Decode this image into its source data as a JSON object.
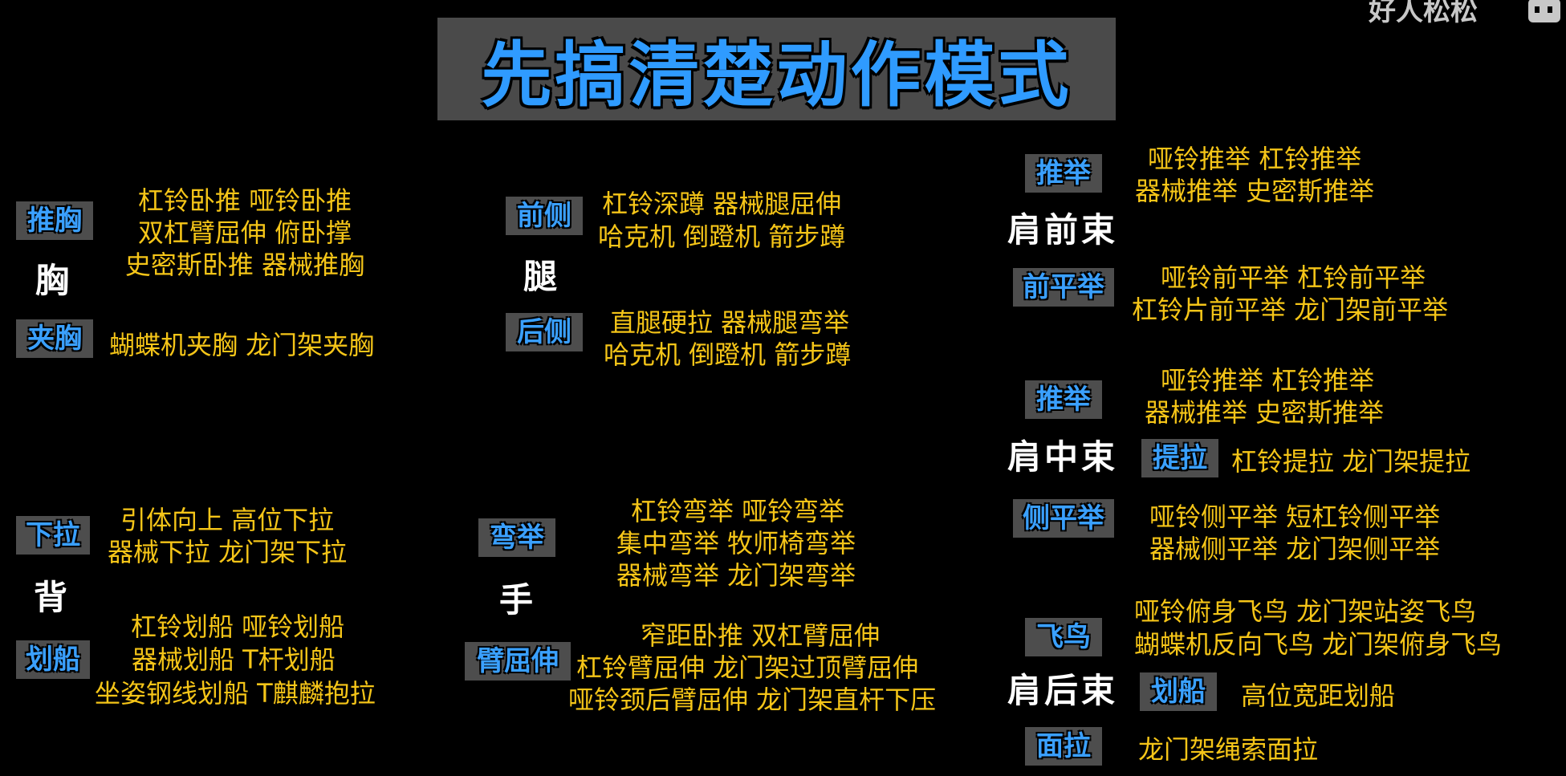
{
  "title": "先搞清楚动作模式",
  "watermark": "好人松松",
  "groups": {
    "chest": {
      "name": "胸",
      "push_tag": "推胸",
      "push_line1": "杠铃卧推 哑铃卧推",
      "push_line2": "双杠臂屈伸 俯卧撑",
      "push_line3": "史密斯卧推 器械推胸",
      "fly_tag": "夹胸",
      "fly_line1": "蝴蝶机夹胸 龙门架夹胸"
    },
    "legs": {
      "name": "腿",
      "front_tag": "前侧",
      "front_line1": "杠铃深蹲 器械腿屈伸",
      "front_line2": "哈克机 倒蹬机 箭步蹲",
      "back_tag": "后侧",
      "back_line1": "直腿硬拉 器械腿弯举",
      "back_line2": "哈克机 倒蹬机 箭步蹲"
    },
    "front_delt": {
      "name": "肩前束",
      "press_tag": "推举",
      "press_line1": "哑铃推举 杠铃推举",
      "press_line2": "器械推举 史密斯推举",
      "raise_tag": "前平举",
      "raise_line1": "哑铃前平举 杠铃前平举",
      "raise_line2": "杠铃片前平举 龙门架前平举"
    },
    "mid_delt": {
      "name": "肩中束",
      "press_tag": "推举",
      "press_line1": "哑铃推举 杠铃推举",
      "press_line2": "器械推举 史密斯推举",
      "pull_tag": "提拉",
      "pull_line1": "杠铃提拉 龙门架提拉",
      "lateral_tag": "侧平举",
      "lateral_line1": "哑铃侧平举 短杠铃侧平举",
      "lateral_line2": "器械侧平举 龙门架侧平举"
    },
    "back": {
      "name": "背",
      "pulldown_tag": "下拉",
      "pulldown_line1": "引体向上 高位下拉",
      "pulldown_line2": "器械下拉 龙门架下拉",
      "row_tag": "划船",
      "row_line1": "杠铃划船 哑铃划船",
      "row_line2": "器械划船  T杆划船",
      "row_line3": "坐姿钢线划船 T麒麟抱拉"
    },
    "arms": {
      "name": "手",
      "curl_tag": "弯举",
      "curl_line1": "杠铃弯举 哑铃弯举",
      "curl_line2": "集中弯举 牧师椅弯举",
      "curl_line3": "器械弯举 龙门架弯举",
      "ext_tag": "臂屈伸",
      "ext_line1": "窄距卧推 双杠臂屈伸",
      "ext_line2": "杠铃臂屈伸  龙门架过顶臂屈伸",
      "ext_line3": "哑铃颈后臂屈伸 龙门架直杆下压"
    },
    "rear_delt": {
      "name": "肩后束",
      "fly_tag": "飞鸟",
      "fly_line1": "哑铃俯身飞鸟 龙门架站姿飞鸟",
      "fly_line2": "蝴蝶机反向飞鸟  龙门架俯身飞鸟",
      "row_tag": "划船",
      "row_line1": "高位宽距划船",
      "facepull_tag": "面拉",
      "facepull_line1": "龙门架绳索面拉"
    }
  },
  "colors": {
    "background": "#000000",
    "tag_bg": "#4d4d4d",
    "tag_text": "#3aa0ff",
    "exercise_text": "#f5c518",
    "muscle_text": "#ffffff"
  }
}
